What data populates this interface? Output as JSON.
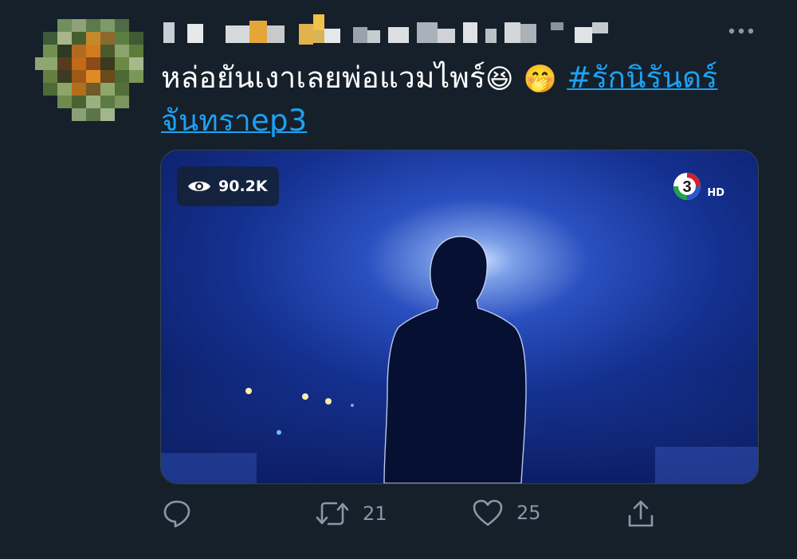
{
  "tweet": {
    "text_plain": "หล่อยันเงาเลยพ่อแวมไพร์",
    "emoji_1": "😆",
    "emoji_2": "🤭",
    "hashtag_part1": "#รักนิรันดร์",
    "hashtag_part2": "จันทราep3"
  },
  "media": {
    "views": "90.2K",
    "channel_number": "3",
    "channel_suffix": "HD"
  },
  "actions": {
    "retweet_count": "21",
    "like_count": "25"
  },
  "colors": {
    "background": "#15202b",
    "hashtag": "#1da1f2",
    "muted": "#8899a6"
  },
  "icons": {
    "more": "more-horizontal-icon",
    "views": "eye-icon",
    "reply": "reply-icon",
    "retweet": "retweet-icon",
    "like": "heart-icon",
    "share": "share-icon"
  }
}
